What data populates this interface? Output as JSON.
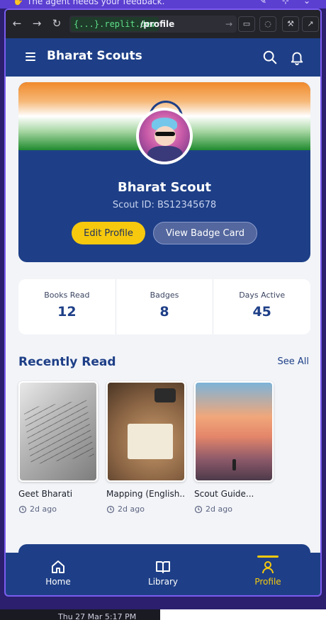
{
  "banner": {
    "message": "The agent needs your feedback."
  },
  "browser": {
    "host": "{...}.replit.dev",
    "path": "/profile"
  },
  "app": {
    "title": "Bharat Scouts"
  },
  "profile": {
    "name": "Bharat Scout",
    "scout_id": "Scout ID: BS12345678",
    "edit_label": "Edit Profile",
    "badge_card_label": "View Badge Card"
  },
  "stats": [
    {
      "label": "Books Read",
      "value": "12"
    },
    {
      "label": "Badges",
      "value": "8"
    },
    {
      "label": "Days Active",
      "value": "45"
    }
  ],
  "recent": {
    "title": "Recently Read",
    "see_all": "See All",
    "books": [
      {
        "title": "Geet Bharati",
        "time": "2d ago"
      },
      {
        "title": "Mapping (English...",
        "time": "2d ago"
      },
      {
        "title": "Scout Guide...",
        "time": "2d ago"
      }
    ]
  },
  "bottom_nav": [
    {
      "label": "Home",
      "icon": "home-icon",
      "active": false
    },
    {
      "label": "Library",
      "icon": "book-open-icon",
      "active": false
    },
    {
      "label": "Profile",
      "icon": "user-icon",
      "active": true
    }
  ],
  "taskbar": {
    "time": "Thu 27 Mar  5:17 PM"
  },
  "colors": {
    "primary": "#1e3f87",
    "accent": "#f6c90e",
    "background": "#f2f4f8"
  }
}
